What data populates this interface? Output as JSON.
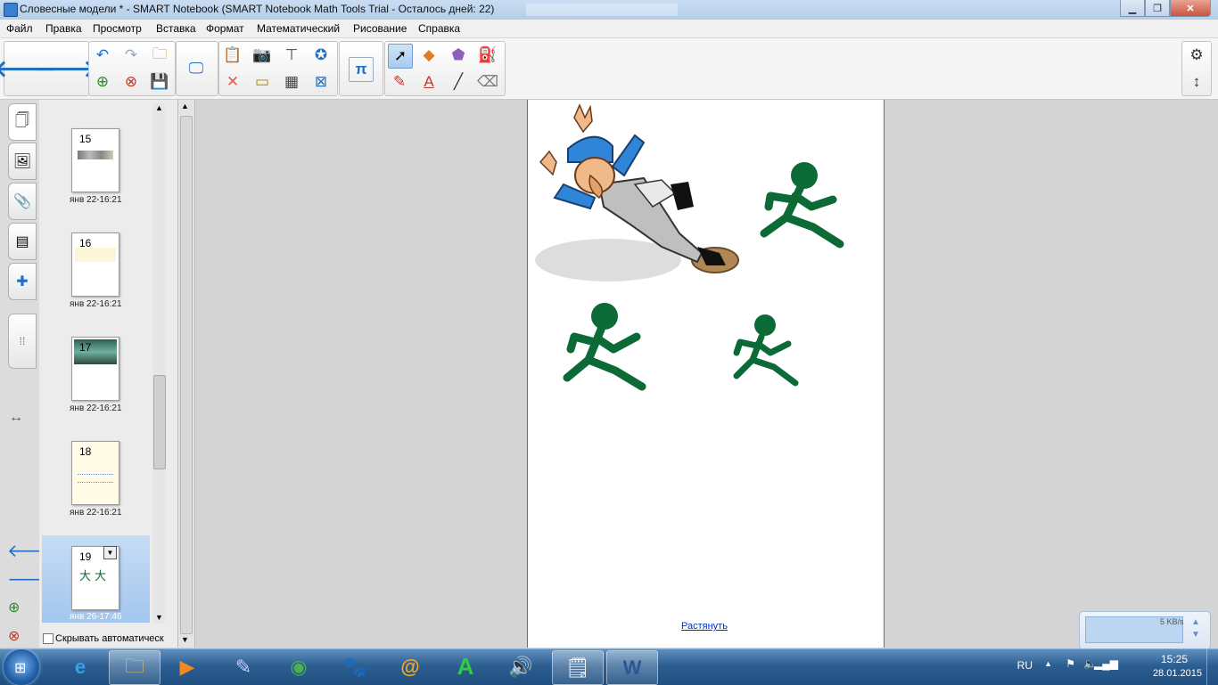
{
  "window": {
    "title": "Словесные модели * - SMART Notebook (SMART Notebook Math Tools Trial - Осталось дней: 22)"
  },
  "menu": {
    "items": [
      "Файл",
      "Правка",
      "Просмотр",
      "Вставка",
      "Формат",
      "Математический",
      "Рисование",
      "Справка"
    ]
  },
  "toolbar": {
    "pi_label": "π",
    "text_label": "A"
  },
  "sorter": {
    "pages": [
      {
        "number": "15",
        "date": "янв 22-16:21"
      },
      {
        "number": "16",
        "date": "янв 22-16:21"
      },
      {
        "number": "17",
        "date": "янв 22-16:21"
      },
      {
        "number": "18",
        "date": "янв 22-16:21"
      },
      {
        "number": "19",
        "date": "янв 26-17:46"
      }
    ],
    "autohide_label": "Скрывать автоматическ"
  },
  "canvas": {
    "stretch_link": "Растянуть"
  },
  "network_widget": {
    "speed": "5 KB/s"
  },
  "taskbar": {
    "lang": "RU",
    "time": "15:25",
    "date": "28.01.2015"
  },
  "colors": {
    "figure_green": "#0b6a36",
    "accent_blue": "#1f6fc5"
  }
}
